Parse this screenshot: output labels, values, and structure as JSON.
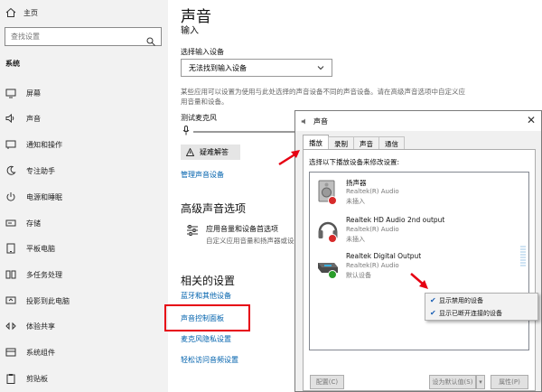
{
  "nav": {
    "home": "主页",
    "search_placeholder": "查找设置",
    "section": "系统",
    "items": [
      {
        "label": "屏幕",
        "icon": "display-icon"
      },
      {
        "label": "声音",
        "icon": "speaker-icon"
      },
      {
        "label": "通知和操作",
        "icon": "notification-icon"
      },
      {
        "label": "专注助手",
        "icon": "focus-assist-icon"
      },
      {
        "label": "电源和睡眠",
        "icon": "power-icon"
      },
      {
        "label": "存储",
        "icon": "storage-icon"
      },
      {
        "label": "平板电脑",
        "icon": "tablet-icon"
      },
      {
        "label": "多任务处理",
        "icon": "multitasking-icon"
      },
      {
        "label": "投影到此电脑",
        "icon": "project-icon"
      },
      {
        "label": "体验共享",
        "icon": "shared-experience-icon"
      },
      {
        "label": "系统组件",
        "icon": "system-components-icon"
      },
      {
        "label": "剪贴板",
        "icon": "clipboard-icon"
      }
    ]
  },
  "main": {
    "title": "声音",
    "input_heading": "输入",
    "choose_input_label": "选择输入设备",
    "input_dropdown_value": "无法找到输入设备",
    "input_desc": "某些应用可以设置为使用与此处选择的声音设备不同的声音设备。请在高级声音选项中自定义应用音量和设备。",
    "test_mic_label": "测试麦克风",
    "troubleshoot_label": "疑难解答",
    "manage_devices_link": "管理声音设备",
    "advanced_heading": "高级声音选项",
    "app_pref_title": "应用音量和设备首选项",
    "app_pref_desc": "自定义应用音量和扬声器或设备",
    "related_heading": "相关的设置",
    "related_links": [
      "蓝牙和其他设备",
      "声音控制面板",
      "麦克风隐私设置",
      "轻松访问音频设置"
    ]
  },
  "dialog": {
    "title": "声音",
    "close_glyph": "✕",
    "tabs": [
      "播放",
      "录制",
      "声音",
      "通信"
    ],
    "active_tab": "播放",
    "instruction": "选择以下播放设备来修改设置:",
    "devices": [
      {
        "name": "扬声器",
        "driver": "Realtek(R) Audio",
        "status": "未插入",
        "badge": "red",
        "icon": "speaker-device-icon"
      },
      {
        "name": "Realtek HD Audio 2nd output",
        "driver": "Realtek(R) Audio",
        "status": "未插入",
        "badge": "red",
        "icon": "headphones-device-icon"
      },
      {
        "name": "Realtek Digital Output",
        "driver": "Realtek(R) Audio",
        "status": "默认设备",
        "badge": "green",
        "icon": "digital-output-device-icon"
      }
    ],
    "context_menu": [
      {
        "label": "显示禁用的设备",
        "checked": true
      },
      {
        "label": "显示已断开连接的设备",
        "checked": true
      }
    ],
    "buttons": {
      "configure": "配置(C)",
      "set_default": "设为默认值(S)",
      "properties": "属性(P)"
    }
  },
  "colors": {
    "link": "#0062ad",
    "highlight": "#e60012",
    "annotation_arrow": "#e60012"
  }
}
